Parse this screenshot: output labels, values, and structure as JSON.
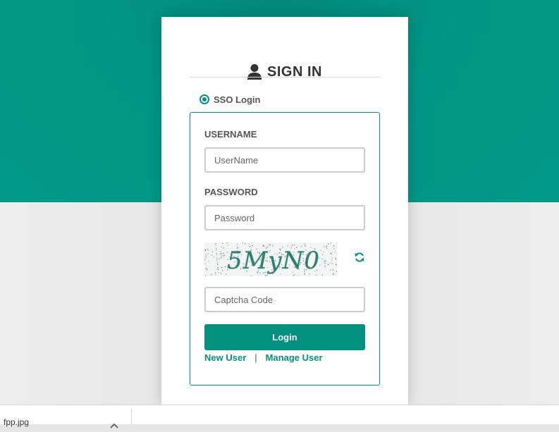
{
  "header": {
    "title": "SIGN IN",
    "icon": "user-icon"
  },
  "login_option": {
    "label": "SSO Login",
    "selected": true
  },
  "form": {
    "username_label": "USERNAME",
    "username_placeholder": "UserName",
    "username_value": "",
    "password_label": "PASSWORD",
    "password_placeholder": "Password",
    "password_value": "",
    "captcha_text": "5MyN0",
    "captcha_refresh_icon": "refresh-icon",
    "captcha_placeholder": "Captcha Code",
    "captcha_value": "",
    "login_button": "Login",
    "new_user_link": "New User",
    "separator": "|",
    "manage_user_link": "Manage User"
  },
  "download_bar": {
    "file_name": "fpp.jpg",
    "chevron_icon": "chevron-up-icon"
  },
  "colors": {
    "accent": "#00917f",
    "header_bg": "#009584",
    "page_bg": "#e6e6e6"
  }
}
